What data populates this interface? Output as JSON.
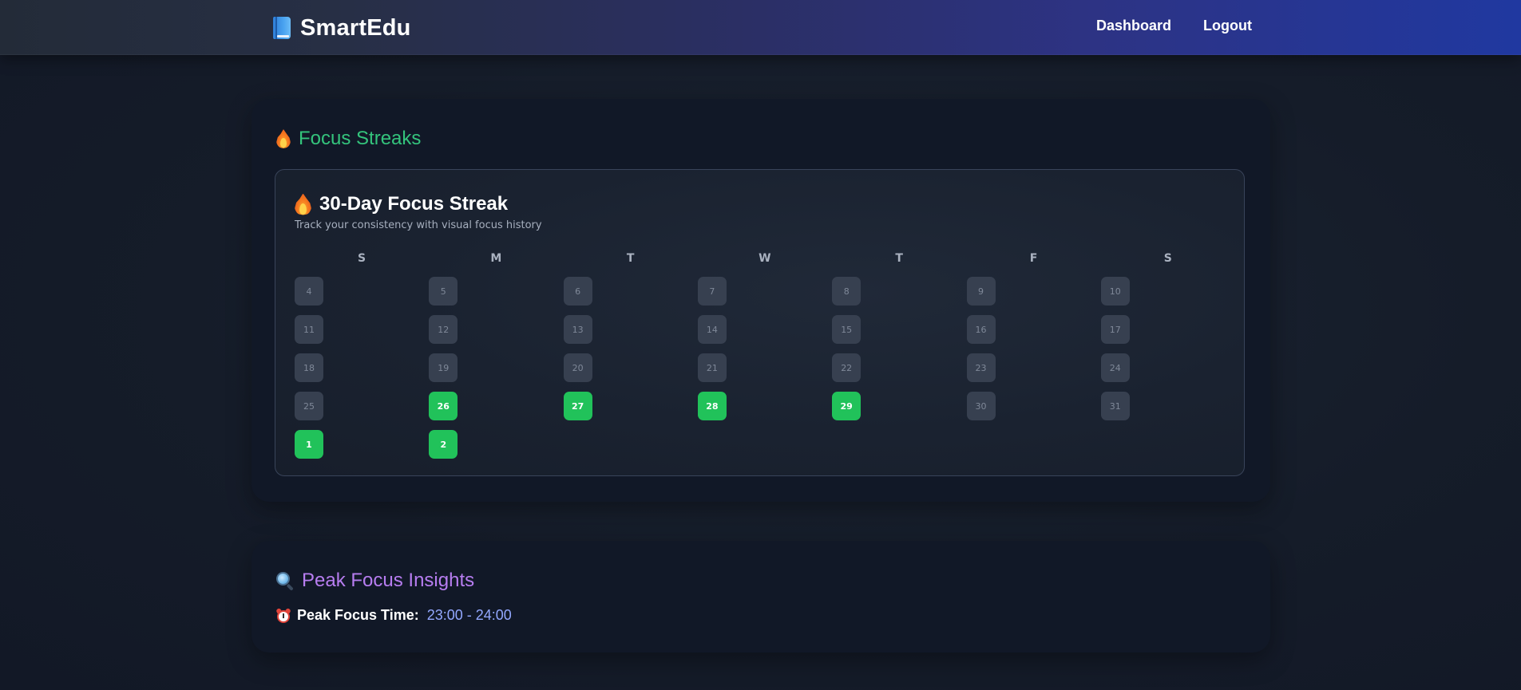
{
  "header": {
    "brand": "SmartEdu",
    "nav": [
      {
        "label": "Dashboard"
      },
      {
        "label": "Logout"
      }
    ]
  },
  "streaks_section": {
    "title": "Focus Streaks",
    "panel": {
      "title": "30-Day Focus Streak",
      "subtitle": "Track your consistency with visual focus history",
      "weekdays": [
        "S",
        "M",
        "T",
        "W",
        "T",
        "F",
        "S"
      ],
      "weeks": [
        [
          {
            "day": "4",
            "active": false
          },
          {
            "day": "5",
            "active": false
          },
          {
            "day": "6",
            "active": false
          },
          {
            "day": "7",
            "active": false
          },
          {
            "day": "8",
            "active": false
          },
          {
            "day": "9",
            "active": false
          },
          {
            "day": "10",
            "active": false
          }
        ],
        [
          {
            "day": "11",
            "active": false
          },
          {
            "day": "12",
            "active": false
          },
          {
            "day": "13",
            "active": false
          },
          {
            "day": "14",
            "active": false
          },
          {
            "day": "15",
            "active": false
          },
          {
            "day": "16",
            "active": false
          },
          {
            "day": "17",
            "active": false
          }
        ],
        [
          {
            "day": "18",
            "active": false
          },
          {
            "day": "19",
            "active": false
          },
          {
            "day": "20",
            "active": false
          },
          {
            "day": "21",
            "active": false
          },
          {
            "day": "22",
            "active": false
          },
          {
            "day": "23",
            "active": false
          },
          {
            "day": "24",
            "active": false
          }
        ],
        [
          {
            "day": "25",
            "active": false
          },
          {
            "day": "26",
            "active": true
          },
          {
            "day": "27",
            "active": true
          },
          {
            "day": "28",
            "active": true
          },
          {
            "day": "29",
            "active": true
          },
          {
            "day": "30",
            "active": false
          },
          {
            "day": "31",
            "active": false
          }
        ],
        [
          {
            "day": "1",
            "active": true
          },
          {
            "day": "2",
            "active": true
          }
        ]
      ]
    }
  },
  "insights_section": {
    "title": "Peak Focus Insights",
    "peak_label": "Peak Focus Time:",
    "peak_value": "23:00 - 24:00"
  },
  "colors": {
    "streak_title": "#34c47c",
    "insights_title": "#b77df0",
    "active_day": "#21c25a",
    "inactive_day": "#374050",
    "peak_value": "#93a8ff"
  }
}
